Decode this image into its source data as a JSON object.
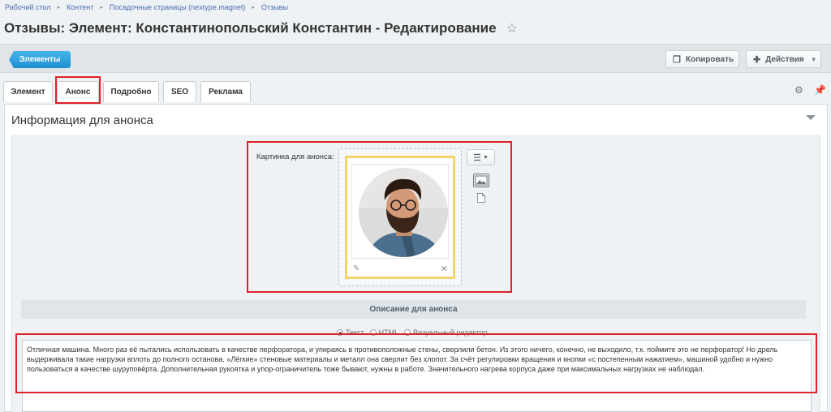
{
  "breadcrumbs": [
    "Рабочий стол",
    "Контент",
    "Посадочные страницы (nextype.magnet)",
    "Отзывы"
  ],
  "page": {
    "title": "Отзывы: Элемент: Константинопольский Константин - Редактирование",
    "star_icon": "star-outline-icon"
  },
  "toolbar": {
    "elements_label": "Элементы",
    "copy_label": "Копировать",
    "actions_label": "Действия"
  },
  "tabs": [
    {
      "label": "Элемент"
    },
    {
      "label": "Анонс",
      "active": true
    },
    {
      "label": "Подробно"
    },
    {
      "label": "SEO"
    },
    {
      "label": "Реклама"
    }
  ],
  "section": {
    "title": "Информация для анонса",
    "image_label": "Картинка для анонса:",
    "description_header": "Описание для анонса",
    "format_options": [
      {
        "label": "Текст",
        "selected": true
      },
      {
        "label": "HTML",
        "selected": false
      },
      {
        "label": "Визуальный редактор",
        "selected": false
      }
    ],
    "description_text": "Отличная машина. Много раз её пытались использовать в качестве перфоратора, и упираясь в противоположные стены, сверлили бетон. Из этого ничего, конечно, не выходило, т.к. поймите это не перфоратор! Но дрель выдерживала такие нагрузки вплоть до полного останова. «Лёгкие» стеновые материалы и металл она сверлит без хлопот. За счёт регулировки вращения и кнопки «с постепенным нажатием», машиной удобно и нужно пользоваться в качестве шуруповёрта. Дополнительная рукоятка и упор-ограничитель тоже бывают, нужны в работе. Значительного нагрева корпуса даже при максимальных нагрузках не наблюдал."
  },
  "colors": {
    "accent": "#1d8fd0",
    "highlight": "#e0202a",
    "image_frame": "#f4d46c"
  }
}
